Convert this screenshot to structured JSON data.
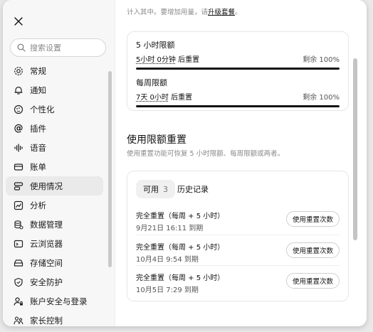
{
  "sidebar": {
    "search_placeholder": "搜索设置",
    "items": [
      {
        "label": "常规",
        "icon": "gear-icon"
      },
      {
        "label": "通知",
        "icon": "bell-icon"
      },
      {
        "label": "个性化",
        "icon": "palette-icon"
      },
      {
        "label": "插件",
        "icon": "at-sign-icon"
      },
      {
        "label": "语音",
        "icon": "waveform-icon"
      },
      {
        "label": "账单",
        "icon": "card-icon"
      },
      {
        "label": "使用情况",
        "icon": "usage-icon",
        "active": true
      },
      {
        "label": "分析",
        "icon": "chart-icon"
      },
      {
        "label": "数据管理",
        "icon": "database-icon"
      },
      {
        "label": "云浏览器",
        "icon": "cloud-icon"
      },
      {
        "label": "存储空间",
        "icon": "storage-icon"
      },
      {
        "label": "安全防护",
        "icon": "shield-icon"
      },
      {
        "label": "账户安全与登录",
        "icon": "user-lock-icon"
      },
      {
        "label": "家长控制",
        "icon": "family-icon"
      }
    ]
  },
  "main": {
    "top_note": {
      "prefix": "计入其中。要增加用量，请",
      "link": "升级套餐",
      "suffix": "。"
    },
    "limits": [
      {
        "title": "5 小时限额",
        "reset_time": "5小时 0分钟",
        "reset_suffix": "后重置",
        "remaining": "剩余 100%",
        "remaining_fraction": 1.0
      },
      {
        "title": "每周限额",
        "reset_time": "7天 0小时",
        "reset_suffix": "后重置",
        "remaining": "剩余 100%",
        "remaining_fraction": 1.0
      }
    ],
    "reset_section": {
      "title": "使用限额重置",
      "description": "使用重置功能可恢复 5 小时限额、每周限额或两者。",
      "tabs": {
        "available_label": "可用",
        "available_count": "3",
        "history_label": "历史记录"
      },
      "items": [
        {
          "name": "完全重置（每周 + 5 小时）",
          "expiry": "9月21日 16:11 到期",
          "button": "使用重置次数"
        },
        {
          "name": "完全重置（每周 + 5 小时）",
          "expiry": "10月4日 9:54 到期",
          "button": "使用重置次数"
        },
        {
          "name": "完全重置（每周 + 5 小时）",
          "expiry": "10月5日 7:29 到期",
          "button": "使用重置次数"
        }
      ]
    }
  },
  "colors": {
    "accent": "#111111",
    "muted_text": "#8a8a8a",
    "bar_fill": "#111111",
    "bar_track": "#e4e4e4"
  }
}
